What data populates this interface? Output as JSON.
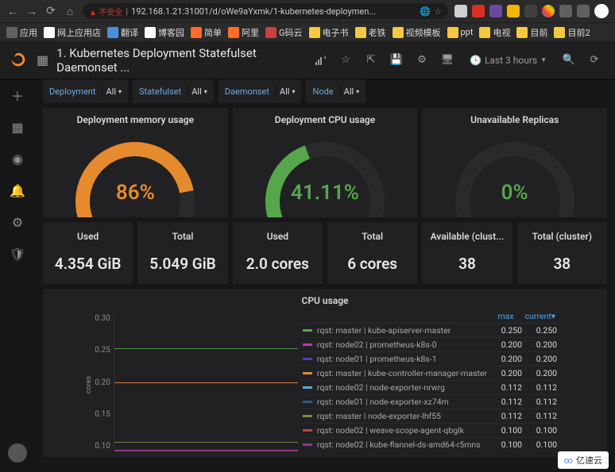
{
  "browser": {
    "url_warn": "▲ 不安全",
    "url": "192.168.1.21:31001/d/oWe9aYxmk/1-kubernetes-deploymen...",
    "bookmarks": [
      {
        "label": "应用",
        "color": "#606060"
      },
      {
        "label": "网上应用店",
        "color": "#ffffff"
      },
      {
        "label": "翻译",
        "color": "#4a90d9"
      },
      {
        "label": "博客园",
        "color": "#ffffff"
      },
      {
        "label": "简单",
        "color": "#ff6b2b"
      },
      {
        "label": "阿里",
        "color": "#ff6b2b"
      },
      {
        "label": "G码云",
        "color": "#c84040"
      },
      {
        "label": "电子书",
        "color": "#f5c842"
      },
      {
        "label": "老铁",
        "color": "#f5c842"
      },
      {
        "label": "视频模板",
        "color": "#f5c842"
      },
      {
        "label": "ppt",
        "color": "#f5c842"
      },
      {
        "label": "电视",
        "color": "#f5c842"
      },
      {
        "label": "目前",
        "color": "#f5c842"
      },
      {
        "label": "目前2",
        "color": "#f5c842"
      }
    ]
  },
  "dashboard": {
    "title": "1. Kubernetes Deployment Statefulset Daemonset ...",
    "time_range": "Last 3 hours"
  },
  "vars": [
    {
      "label": "Deployment",
      "value": "All"
    },
    {
      "label": "Statefulset",
      "value": "All"
    },
    {
      "label": "Daemonset",
      "value": "All"
    },
    {
      "label": "Node",
      "value": "All"
    }
  ],
  "gauges": [
    {
      "title": "Deployment memory usage",
      "value": "86%",
      "pct": 86,
      "color": "#e68a2e",
      "valColor": "#e68a2e"
    },
    {
      "title": "Deployment CPU usage",
      "value": "41.11%",
      "pct": 41.11,
      "color": "#56a64b",
      "valColor": "#56a64b"
    },
    {
      "title": "Unavailable Replicas",
      "value": "0%",
      "pct": 0,
      "color": "#c4162a",
      "valColor": "#56a64b"
    }
  ],
  "stats": [
    {
      "title": "Used",
      "value": "4.354 GiB"
    },
    {
      "title": "Total",
      "value": "5.049 GiB"
    },
    {
      "title": "Used",
      "value": "2.0 cores"
    },
    {
      "title": "Total",
      "value": "6 cores"
    },
    {
      "title": "Available (clust...",
      "value": "38"
    },
    {
      "title": "Total (cluster)",
      "value": "38"
    }
  ],
  "chart_data": {
    "type": "line",
    "title": "CPU usage",
    "ylabel": "cores",
    "ylim": [
      0.1,
      0.3
    ],
    "yticks": [
      "0.30",
      "0.25",
      "0.20",
      "0.15",
      "0.10"
    ],
    "columns": [
      "max",
      "current▾"
    ],
    "series": [
      {
        "name": "rqst: master | kube-apiserver-master",
        "color": "#56a64b",
        "max": 0.25,
        "current": 0.25
      },
      {
        "name": "rqst: node02 | prometheus-k8s-0",
        "color": "#b83fa8",
        "max": 0.2,
        "current": 0.2
      },
      {
        "name": "rqst: node01 | prometheus-k8s-1",
        "color": "#4a3fb8",
        "max": 0.2,
        "current": 0.2
      },
      {
        "name": "rqst: master | kube-controller-manager-master",
        "color": "#e68a2e",
        "max": 0.2,
        "current": 0.2
      },
      {
        "name": "rqst: node02 | node-exporter-nrwrg",
        "color": "#5fa8d8",
        "max": 0.112,
        "current": 0.112
      },
      {
        "name": "rqst: node01 | node-exporter-xz74m",
        "color": "#2e5a8a",
        "max": 0.112,
        "current": 0.112
      },
      {
        "name": "rqst: master | node-exporter-lhf55",
        "color": "#7a8a3a",
        "max": 0.112,
        "current": 0.112
      },
      {
        "name": "rqst: node02 | weave-scope-agent-qbglk",
        "color": "#b84a3a",
        "max": 0.1,
        "current": 0.1
      },
      {
        "name": "rqst: node02 | kube-flannel-ds-amd64-r5mns",
        "color": "#8a3a8a",
        "max": 0.1,
        "current": 0.1
      }
    ]
  },
  "watermark": "亿速云"
}
